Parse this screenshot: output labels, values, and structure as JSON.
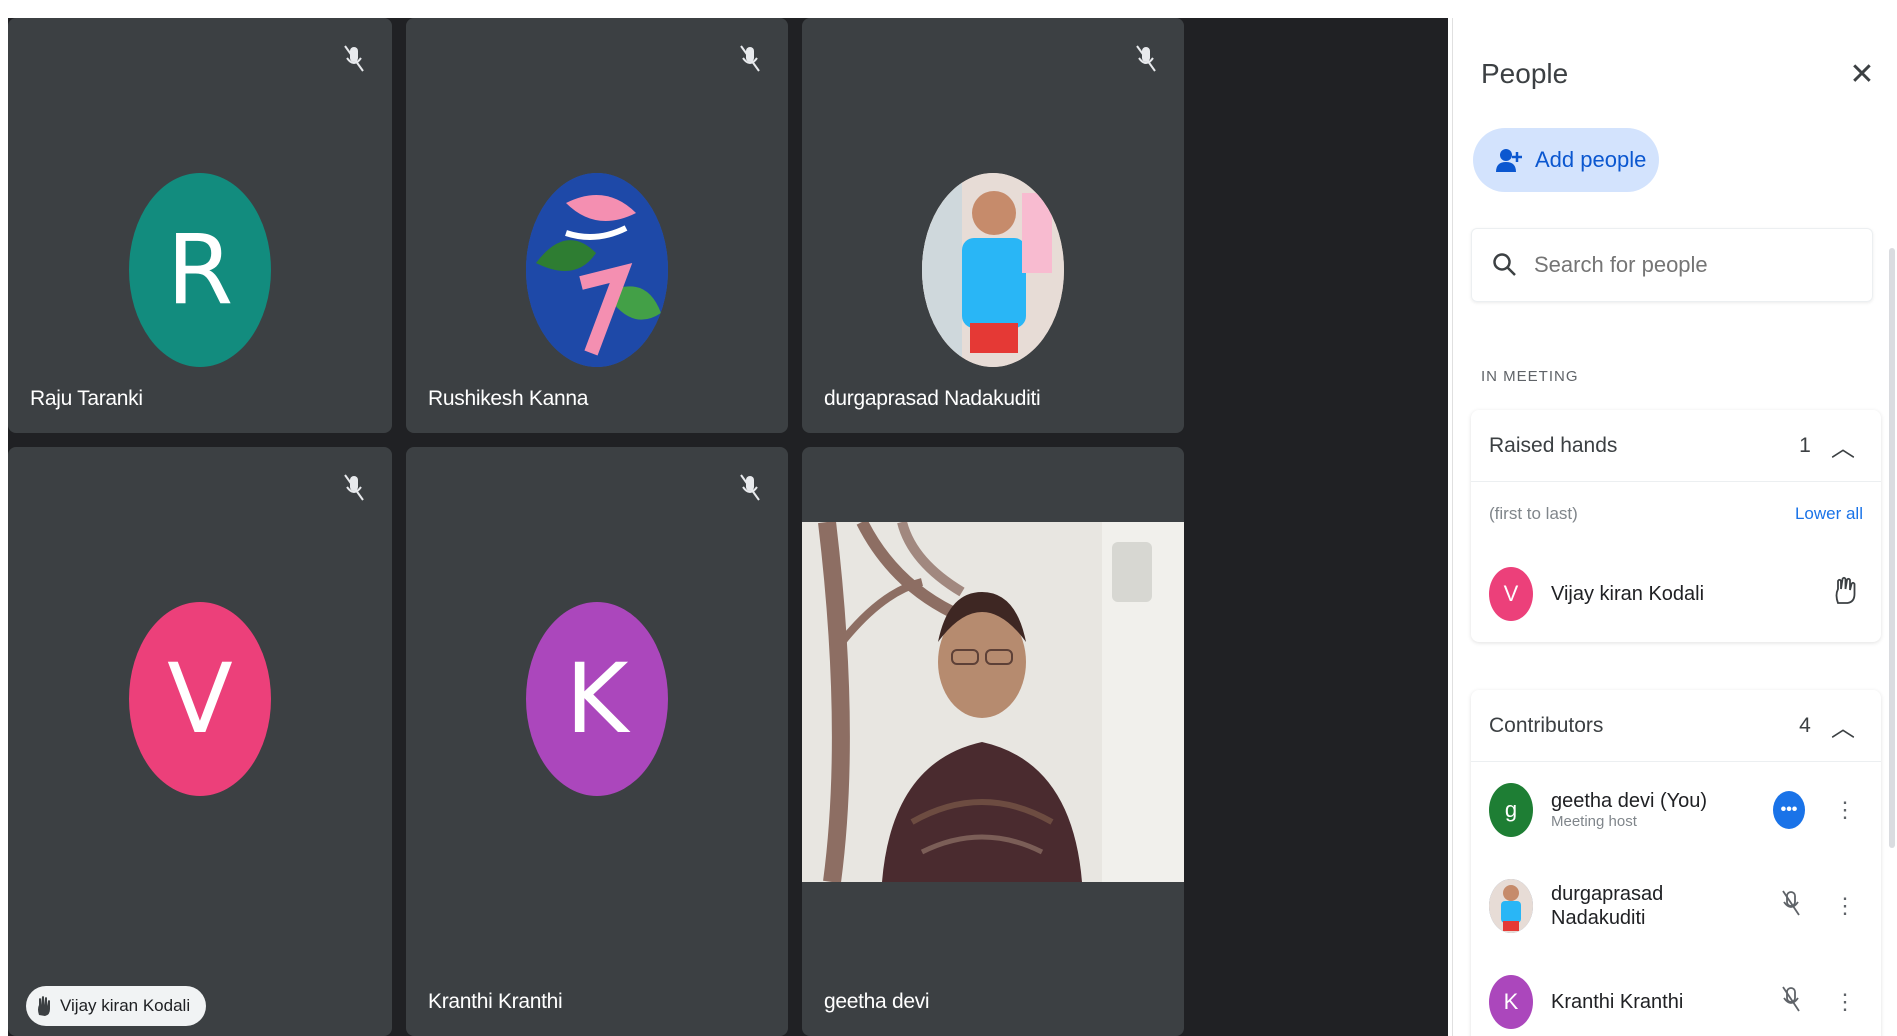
{
  "tiles": [
    {
      "name": "Raju Taranki",
      "initial": "R",
      "color": "#128c7e",
      "muted": true
    },
    {
      "name": "Rushikesh Kanna",
      "initial": "",
      "color": "#2a5bbf",
      "muted": true
    },
    {
      "name": "durgaprasad Nadakuditi",
      "initial": "",
      "color": "#7fb7d8",
      "muted": true
    },
    {
      "name": "",
      "initial": "V",
      "color": "#ec407a",
      "muted": true,
      "hand_chip": "Vijay kiran Kodali"
    },
    {
      "name": "Kranthi Kranthi",
      "initial": "K",
      "color": "#ab47bc",
      "muted": true
    },
    {
      "name": "geetha devi",
      "initial": "",
      "color": "#e9e9e7",
      "video": true
    }
  ],
  "panel": {
    "title": "People",
    "add_label": "Add people",
    "search_placeholder": "Search for people",
    "section": "IN MEETING",
    "raised": {
      "label": "Raised hands",
      "count": "1",
      "order": "(first to last)",
      "lower_all": "Lower all",
      "people": [
        {
          "initial": "V",
          "name": "Vijay kiran Kodali",
          "color": "#ec407a"
        }
      ]
    },
    "contributors": {
      "label": "Contributors",
      "count": "4",
      "people": [
        {
          "initial": "g",
          "name": "geetha devi (You)",
          "sub": "Meeting host",
          "color": "#1e7e34"
        },
        {
          "initial": "",
          "name": "durgaprasad Nadakuditi",
          "sub": "",
          "color": "#6b8fb5"
        },
        {
          "initial": "K",
          "name": "Kranthi Kranthi",
          "sub": "",
          "color": "#ab47bc"
        }
      ]
    }
  },
  "colors": {
    "stage": "#202124",
    "tile": "#3c4043",
    "accent": "#1a73e8",
    "add_button": "#d3e3fd"
  },
  "icons": {
    "muted": "mic-off-icon",
    "close": "close-icon",
    "add": "person-add-icon",
    "search": "search-icon",
    "hand": "raised-hand-icon",
    "more": "more-vert-icon"
  }
}
